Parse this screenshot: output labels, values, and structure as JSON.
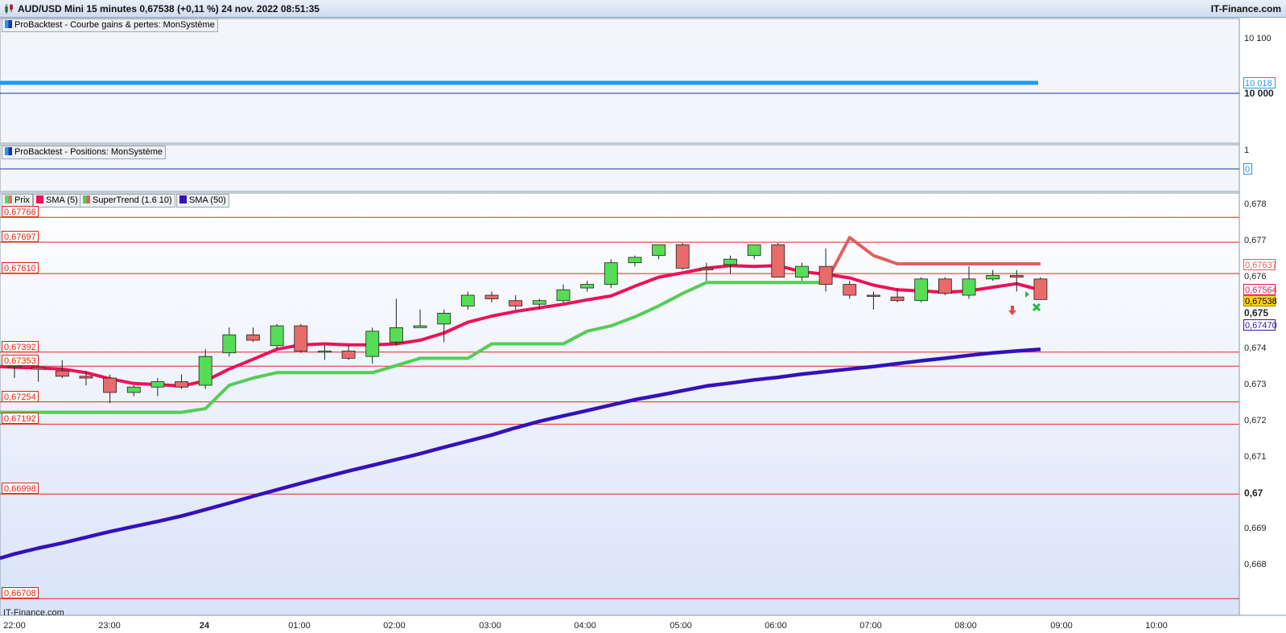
{
  "window": {
    "title": "AUD/USD Mini 15 minutes 0,67538 (+0,11 %) 24 nov. 2022 08:51:35",
    "brand": "IT-Finance.com",
    "source": "IT-Finance.com"
  },
  "colors": {
    "up_candle": "#55dd55",
    "down_candle": "#e86a6a",
    "sma5": "#ee1155",
    "supertrend_up": "#55cc55",
    "supertrend_down": "#e06060",
    "sma50": "#3311bb",
    "equity": "#2299ee",
    "level_line": "#ee2222",
    "bg_top": "#ffffff",
    "bg_bottom": "#d9e3f8"
  },
  "panels": {
    "equity": {
      "tag": "ProBacktest - Courbe gains & pertes: MonSystème",
      "axis": [
        "10 100",
        "10 000"
      ],
      "current_value": "10 018"
    },
    "positions": {
      "tag": "ProBacktest - Positions: MonSystème",
      "axis": [
        "1"
      ],
      "current_value": "0"
    },
    "price": {
      "legend": [
        {
          "name": "Prix",
          "icon": "up-down-candle-icon"
        },
        {
          "name": "SMA (5)",
          "icon": "square-icon"
        },
        {
          "name": "SuperTrend (1.6 10)",
          "icon": "square-icon"
        },
        {
          "name": "SMA (50)",
          "icon": "square-icon"
        }
      ],
      "axis": [
        "0,678",
        "0,677",
        "0,676",
        "0,675",
        "0,674",
        "0,673",
        "0,672",
        "0,671",
        "0,67",
        "0,669",
        "0,668"
      ],
      "level_labels": [
        "0,67766",
        "0,67697",
        "0,67610",
        "0,67392",
        "0,67353",
        "0,67254",
        "0,67192",
        "0,66998",
        "0,66708"
      ],
      "value_tags": {
        "supertrend": "0,67637",
        "sma5": "0,67564",
        "last_price": "0,67538",
        "sma50": "0,67470"
      }
    }
  },
  "time_axis": [
    "22:00",
    "23:00",
    "24",
    "01:00",
    "02:00",
    "03:00",
    "04:00",
    "05:00",
    "06:00",
    "07:00",
    "08:00",
    "09:00",
    "10:00"
  ],
  "chart_data": {
    "type": "candlestick",
    "interval": "15 minutes",
    "levels": [
      0.67766,
      0.67697,
      0.6761,
      0.67392,
      0.67353,
      0.67254,
      0.67192,
      0.66998,
      0.66708
    ],
    "candles": [
      {
        "o": 0.67353,
        "h": 0.6736,
        "l": 0.6732,
        "c": 0.6735
      },
      {
        "o": 0.6735,
        "h": 0.6738,
        "l": 0.6731,
        "c": 0.67345
      },
      {
        "o": 0.6734,
        "h": 0.6737,
        "l": 0.6732,
        "c": 0.67325
      },
      {
        "o": 0.67325,
        "h": 0.6734,
        "l": 0.673,
        "c": 0.6732
      },
      {
        "o": 0.6732,
        "h": 0.6733,
        "l": 0.6725,
        "c": 0.6728
      },
      {
        "o": 0.6728,
        "h": 0.673,
        "l": 0.6727,
        "c": 0.67295
      },
      {
        "o": 0.67295,
        "h": 0.6732,
        "l": 0.6727,
        "c": 0.6731
      },
      {
        "o": 0.6731,
        "h": 0.6733,
        "l": 0.6729,
        "c": 0.67295
      },
      {
        "o": 0.673,
        "h": 0.674,
        "l": 0.6729,
        "c": 0.6738
      },
      {
        "o": 0.6739,
        "h": 0.6746,
        "l": 0.6738,
        "c": 0.6744
      },
      {
        "o": 0.6744,
        "h": 0.6746,
        "l": 0.6742,
        "c": 0.67425
      },
      {
        "o": 0.6741,
        "h": 0.6747,
        "l": 0.674,
        "c": 0.67465
      },
      {
        "o": 0.67465,
        "h": 0.6747,
        "l": 0.6739,
        "c": 0.67395
      },
      {
        "o": 0.67395,
        "h": 0.6741,
        "l": 0.6737,
        "c": 0.67395
      },
      {
        "o": 0.67395,
        "h": 0.6741,
        "l": 0.6737,
        "c": 0.67375
      },
      {
        "o": 0.6738,
        "h": 0.6746,
        "l": 0.6736,
        "c": 0.6745
      },
      {
        "o": 0.6742,
        "h": 0.6754,
        "l": 0.6741,
        "c": 0.6746
      },
      {
        "o": 0.6746,
        "h": 0.6751,
        "l": 0.6746,
        "c": 0.67465
      },
      {
        "o": 0.6747,
        "h": 0.6751,
        "l": 0.6742,
        "c": 0.675
      },
      {
        "o": 0.6752,
        "h": 0.6756,
        "l": 0.6751,
        "c": 0.6755
      },
      {
        "o": 0.6755,
        "h": 0.6756,
        "l": 0.6753,
        "c": 0.6754
      },
      {
        "o": 0.67535,
        "h": 0.6755,
        "l": 0.6751,
        "c": 0.6752
      },
      {
        "o": 0.67525,
        "h": 0.6754,
        "l": 0.6751,
        "c": 0.67535
      },
      {
        "o": 0.67535,
        "h": 0.6758,
        "l": 0.6753,
        "c": 0.67565
      },
      {
        "o": 0.6757,
        "h": 0.6759,
        "l": 0.6756,
        "c": 0.6758
      },
      {
        "o": 0.6758,
        "h": 0.6765,
        "l": 0.6757,
        "c": 0.6764
      },
      {
        "o": 0.6764,
        "h": 0.6766,
        "l": 0.6763,
        "c": 0.67655
      },
      {
        "o": 0.6766,
        "h": 0.6769,
        "l": 0.6765,
        "c": 0.6769
      },
      {
        "o": 0.6769,
        "h": 0.67695,
        "l": 0.6762,
        "c": 0.67625
      },
      {
        "o": 0.67625,
        "h": 0.6764,
        "l": 0.6759,
        "c": 0.6762
      },
      {
        "o": 0.67635,
        "h": 0.6766,
        "l": 0.6761,
        "c": 0.6765
      },
      {
        "o": 0.6766,
        "h": 0.6769,
        "l": 0.6765,
        "c": 0.6769
      },
      {
        "o": 0.6769,
        "h": 0.67695,
        "l": 0.676,
        "c": 0.676
      },
      {
        "o": 0.676,
        "h": 0.6764,
        "l": 0.6759,
        "c": 0.6763
      },
      {
        "o": 0.6763,
        "h": 0.6768,
        "l": 0.6756,
        "c": 0.6758
      },
      {
        "o": 0.6758,
        "h": 0.6759,
        "l": 0.6754,
        "c": 0.6755
      },
      {
        "o": 0.6755,
        "h": 0.6756,
        "l": 0.6751,
        "c": 0.67548
      },
      {
        "o": 0.67545,
        "h": 0.6757,
        "l": 0.6753,
        "c": 0.67535
      },
      {
        "o": 0.67535,
        "h": 0.676,
        "l": 0.6753,
        "c": 0.67595
      },
      {
        "o": 0.67595,
        "h": 0.676,
        "l": 0.6755,
        "c": 0.67555
      },
      {
        "o": 0.6755,
        "h": 0.6763,
        "l": 0.6754,
        "c": 0.67595
      },
      {
        "o": 0.67595,
        "h": 0.6762,
        "l": 0.6759,
        "c": 0.67605
      },
      {
        "o": 0.67605,
        "h": 0.6762,
        "l": 0.6756,
        "c": 0.676
      },
      {
        "o": 0.67595,
        "h": 0.676,
        "l": 0.6754,
        "c": 0.67538
      }
    ],
    "series": [
      {
        "name": "SMA (5)",
        "values": [
          0.6735,
          0.67348,
          0.67345,
          0.67335,
          0.67318,
          0.67305,
          0.67302,
          0.67298,
          0.67312,
          0.67345,
          0.67372,
          0.674,
          0.67412,
          0.67415,
          0.67412,
          0.67412,
          0.67415,
          0.67425,
          0.67445,
          0.67475,
          0.67492,
          0.67505,
          0.67515,
          0.67525,
          0.67537,
          0.67548,
          0.67575,
          0.676,
          0.67612,
          0.67625,
          0.67632,
          0.6763,
          0.67632,
          0.67615,
          0.67608,
          0.67598,
          0.67578,
          0.67565,
          0.67562,
          0.67558,
          0.67562,
          0.67572,
          0.67582,
          0.67564
        ]
      },
      {
        "name": "SuperTrend (1.6 10)",
        "values": [
          0.67225,
          0.67225,
          0.67225,
          0.67225,
          0.67225,
          0.67225,
          0.67225,
          0.67225,
          0.67235,
          0.673,
          0.6732,
          0.67335,
          0.67335,
          0.67335,
          0.67335,
          0.67335,
          0.67355,
          0.67375,
          0.67375,
          0.67375,
          0.67415,
          0.67415,
          0.67415,
          0.67415,
          0.6745,
          0.67465,
          0.6749,
          0.6752,
          0.67555,
          0.67585,
          0.67585,
          0.67585,
          0.67585,
          0.67585,
          0.67585,
          0.6771,
          0.6766,
          0.67637,
          0.67637,
          0.67637,
          0.67637,
          0.67637,
          0.67637,
          0.67637
        ]
      },
      {
        "name": "SMA (50)",
        "values": [
          0.66832,
          0.66848,
          0.66862,
          0.66878,
          0.66894,
          0.66908,
          0.66922,
          0.66937,
          0.66955,
          0.66973,
          0.66992,
          0.6701,
          0.67028,
          0.67045,
          0.67062,
          0.67078,
          0.67094,
          0.6711,
          0.67128,
          0.67145,
          0.67162,
          0.67182,
          0.672,
          0.67215,
          0.6723,
          0.67245,
          0.6726,
          0.67272,
          0.67285,
          0.67298,
          0.67306,
          0.67315,
          0.67322,
          0.67331,
          0.67338,
          0.67345,
          0.67352,
          0.6736,
          0.67368,
          0.67375,
          0.67383,
          0.6739,
          0.67395,
          0.674
        ]
      }
    ],
    "ylim": [
      0.66708,
      0.6783
    ]
  }
}
